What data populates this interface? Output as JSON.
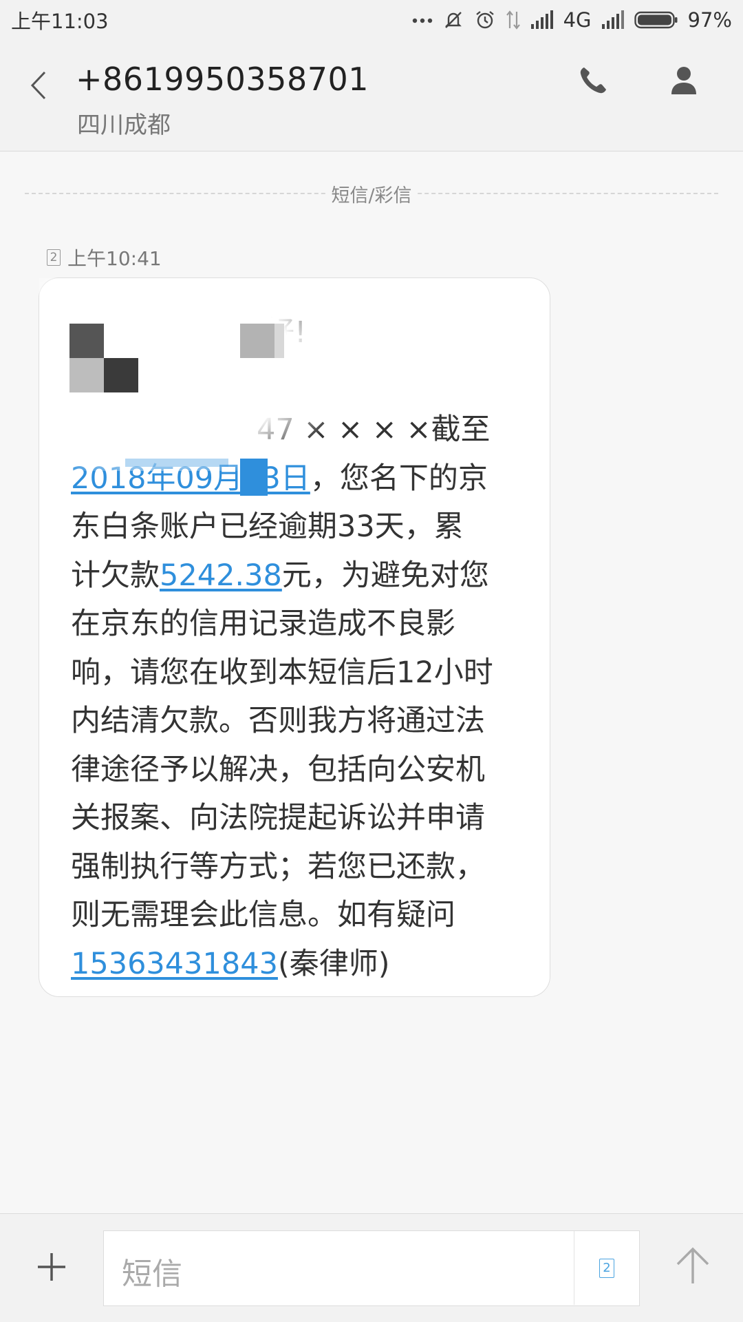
{
  "status_bar": {
    "time": "上午11:03",
    "network": "4G",
    "battery": "97%",
    "icons": [
      "more-dots-icon",
      "mute-vibrate-icon",
      "alarm-icon",
      "data-arrows-icon",
      "signal-icon",
      "signal-icon",
      "battery-icon"
    ]
  },
  "header": {
    "number": "+8619950358701",
    "location": "四川成都",
    "icons": [
      "back-icon",
      "phone-icon",
      "contact-icon"
    ]
  },
  "thread": {
    "channel_label": "短信/彩信",
    "message": {
      "sim": "2",
      "time": "上午10:41",
      "lines": {
        "l1": "好!",
        "l2": "47 × × × ×截至",
        "l3_link": "2018年09月03日",
        "l3_rest": "，您名下的京",
        "l4": "东白条账户已经逾期33天，累",
        "l5_pre": "计欠款",
        "l5_link": "5242.38",
        "l5_post": "元，为避免对您",
        "l6": "在京东的信用记录造成不良影",
        "l7": "响，请您在收到本短信后12小时",
        "l8": "内结清欠款。否则我方将通过法",
        "l9": "律途径予以解决，包括向公安机",
        "l10": "关报案、向法院提起诉讼并申请",
        "l11": "强制执行等方式；若您已还款，",
        "l12": "则无需理会此信息。如有疑问",
        "l13_link": "15363431843",
        "l13_post": "(秦律师)"
      }
    }
  },
  "composer": {
    "placeholder": "短信",
    "sim": "2",
    "icons": [
      "plus-icon",
      "sim-card-icon",
      "send-arrow-icon"
    ]
  }
}
